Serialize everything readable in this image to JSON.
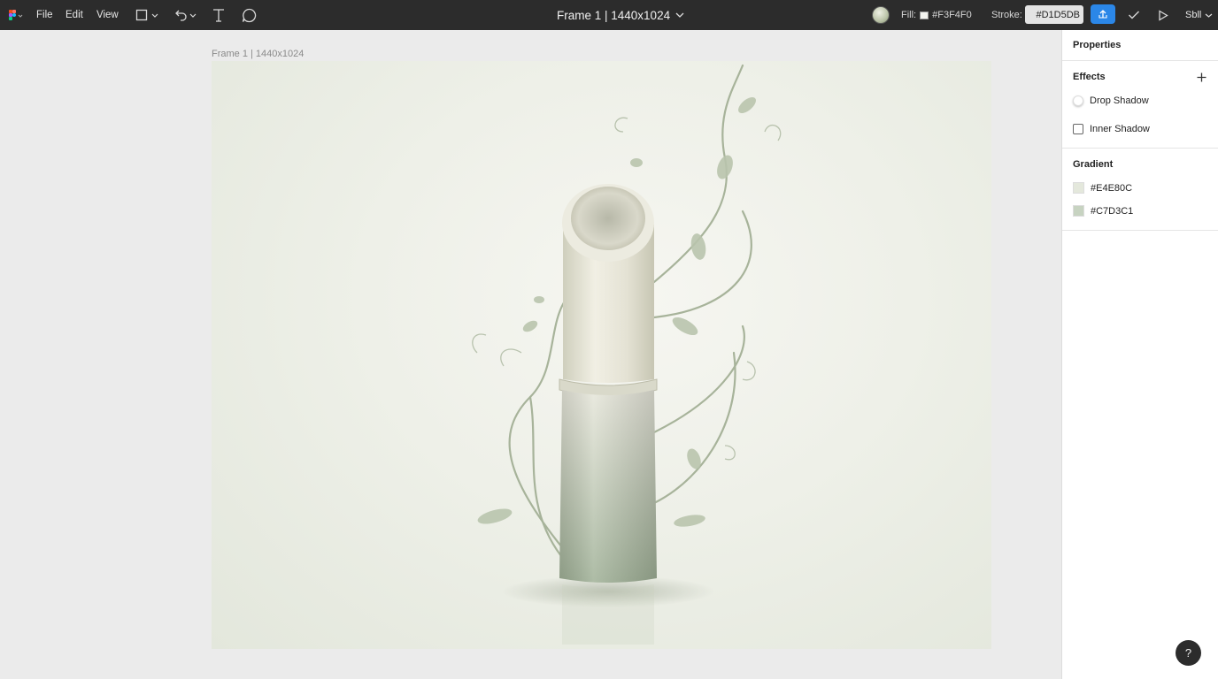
{
  "menu": {
    "file": "File",
    "edit": "Edit",
    "view": "View"
  },
  "title": "Frame 1 | 1440x1024",
  "fill": {
    "label": "Fill:",
    "value": "#F3F4F0"
  },
  "stroke": {
    "label": "Stroke:",
    "value": "#D1D5DB"
  },
  "user": {
    "label": "Sbll"
  },
  "canvas": {
    "frame_label": "Frame 1 | 1440x1024"
  },
  "panel": {
    "title": "Properties",
    "effects": {
      "title": "Effects",
      "items": [
        "Drop Shadow",
        "Inner Shadow"
      ]
    },
    "gradient": {
      "title": "Gradient",
      "stops": [
        {
          "value": "#E4E80C",
          "color": "#E4E8DC"
        },
        {
          "value": "#C7D3C1",
          "color": "#C7D3C1"
        }
      ]
    }
  },
  "help": "?"
}
